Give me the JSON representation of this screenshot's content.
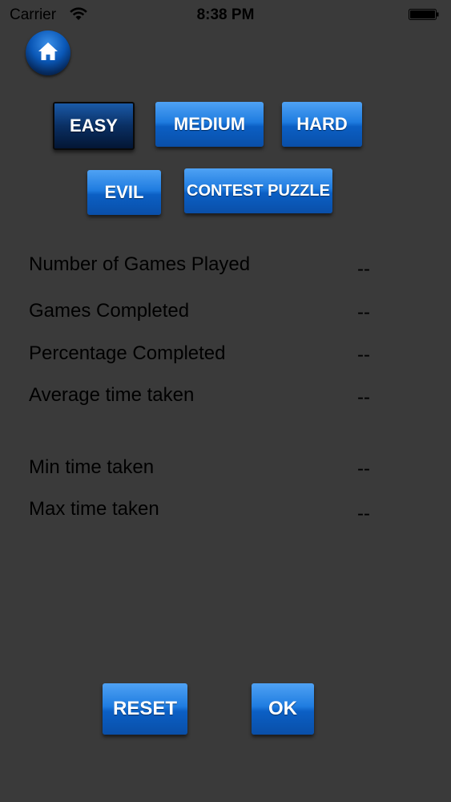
{
  "status_bar": {
    "carrier": "Carrier",
    "time": "8:38 PM"
  },
  "home": {
    "icon": "home-icon"
  },
  "difficulty": {
    "easy": "EASY",
    "medium": "MEDIUM",
    "hard": "HARD",
    "evil": "EVIL",
    "contest": "CONTEST PUZZLE",
    "selected": "EASY"
  },
  "stats": {
    "games_played": {
      "label": "Number of Games Played",
      "value": "--"
    },
    "games_completed": {
      "label": "Games Completed",
      "value": "--"
    },
    "percentage_completed": {
      "label": "Percentage Completed",
      "value": "--"
    },
    "average_time": {
      "label": "Average time taken",
      "value": "--"
    },
    "min_time": {
      "label": "Min time taken",
      "value": "--"
    },
    "max_time": {
      "label": "Max time taken",
      "value": "--"
    }
  },
  "actions": {
    "reset": "RESET",
    "ok": "OK"
  },
  "colors": {
    "background": "#3a3a3a",
    "button_blue": "#1f7ce0",
    "button_selected": "#0a2f63"
  }
}
